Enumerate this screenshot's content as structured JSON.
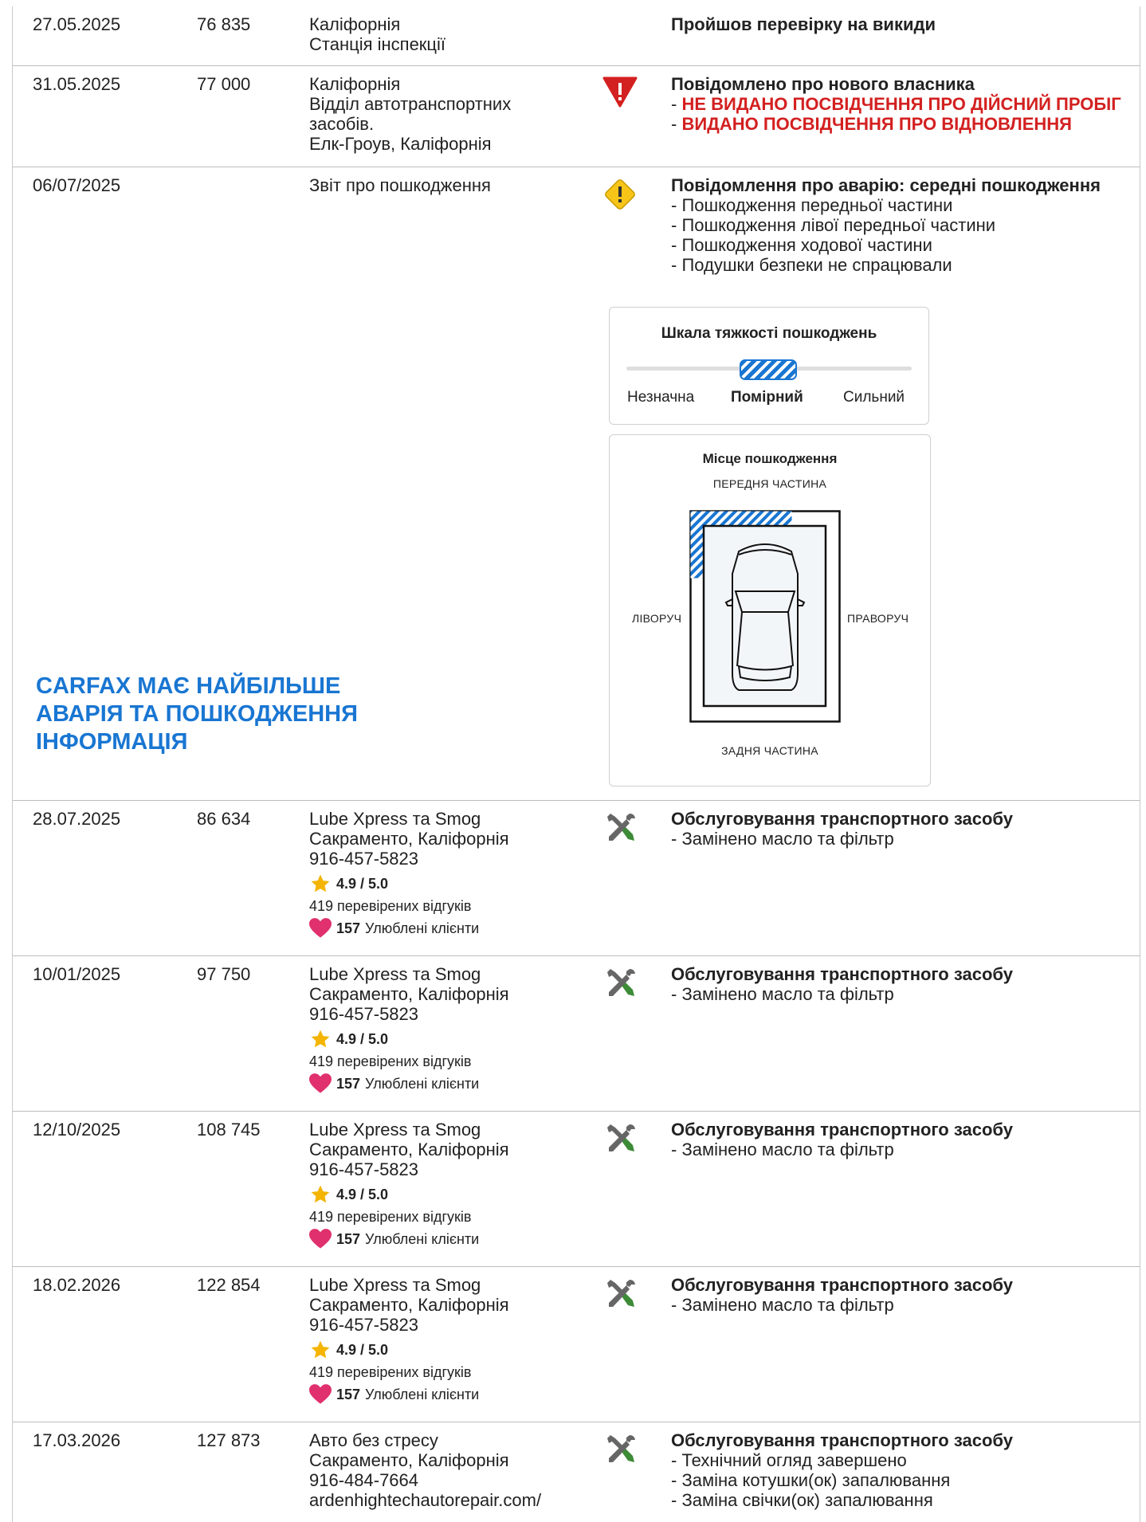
{
  "promo": {
    "line1": "CARFAX МАЄ НАЙБІЛЬШЕ",
    "line2": "АВАРІЯ ТА ПОШКОДЖЕННЯ",
    "line3": "ІНФОРМАЦІЯ"
  },
  "colors": {
    "accent_blue": "#1976d2",
    "alert_red": "#d32020",
    "warning_yellow": "#f7c518",
    "service_green": "#3d8b37",
    "heart_pink": "#e0306e",
    "star_gold": "#f4b400"
  },
  "rows": [
    {
      "date": "27.05.2025",
      "odometer": "76 835",
      "source": [
        "Каліфорнія",
        "Станція інспекції"
      ],
      "icon": "none",
      "title": "Пройшов перевірку на викиди",
      "items": []
    },
    {
      "date": "31.05.2025",
      "odometer": "77 000",
      "source": [
        "Каліфорнія",
        "Відділ автотранспортних",
        "засобів.",
        "Елк-Гроув, Каліфорнія"
      ],
      "icon": "red-alert-icon",
      "title": "Повідомлено про нового власника",
      "alerts": [
        "НЕ ВИДАНО ПОСВІДЧЕННЯ ПРО ДІЙСНИЙ ПРОБІГ",
        "ВИДАНО ПОСВІДЧЕННЯ ПРО ВІДНОВЛЕННЯ"
      ]
    },
    {
      "date": "06/07/2025",
      "odometer": "",
      "source": [
        "Звіт про пошкодження"
      ],
      "icon": "warning-diamond-icon",
      "title": "Повідомлення про аварію: середні пошкодження",
      "items": [
        "Пошкодження передньої частини",
        "Пошкодження лівої передньої частини",
        "Пошкодження ходової частини",
        "Подушки безпеки не спрацювали"
      ]
    },
    {
      "date": "28.07.2025",
      "odometer": "86 634",
      "source": [
        "Lube Xpress та Smog",
        "Сакраменто, Каліфорнія",
        "916-457-5823"
      ],
      "icon": "tools-icon",
      "title": "Обслуговування транспортного засобу",
      "items": [
        "Замінено масло та фільтр"
      ]
    },
    {
      "date": "10/01/2025",
      "odometer": "97 750",
      "source": [
        "Lube Xpress та Smog",
        "Сакраменто, Каліфорнія",
        "916-457-5823"
      ],
      "icon": "tools-icon",
      "title": "Обслуговування транспортного засобу",
      "items": [
        "Замінено масло та фільтр"
      ]
    },
    {
      "date": "12/10/2025",
      "odometer": "108 745",
      "source": [
        "Lube Xpress та Smog",
        "Сакраменто, Каліфорнія",
        "916-457-5823"
      ],
      "icon": "tools-icon",
      "title": "Обслуговування транспортного засобу",
      "items": [
        "Замінено масло та фільтр"
      ]
    },
    {
      "date": "18.02.2026",
      "odometer": "122 854",
      "source": [
        "Lube Xpress та Smog",
        "Сакраменто, Каліфорнія",
        "916-457-5823"
      ],
      "icon": "tools-icon",
      "title": "Обслуговування транспортного засобу",
      "items": [
        "Замінено масло та фільтр"
      ]
    },
    {
      "date": "17.03.2026",
      "odometer": "127 873",
      "source": [
        "Авто без стресу",
        "Сакраменто, Каліфорнія",
        "916-484-7664",
        "ardenhightechautorepair.com/"
      ],
      "icon": "tools-icon",
      "title": "Обслуговування транспортного засобу",
      "items": [
        "Технічний огляд завершено",
        "Заміна котушки(ок) запалювання",
        "Заміна свічки(ок) запалювання"
      ]
    }
  ],
  "shop_meta": {
    "rating": "4.9 / 5.0",
    "reviews": "419 перевірених відгуків",
    "favorites_count": "157",
    "favorites_label": "Улюблені клієнти"
  },
  "severity": {
    "title": "Шкала тяжкості пошкоджень",
    "minor": "Незначна",
    "moderate": "Помірний",
    "severe": "Сильний",
    "level": "moderate"
  },
  "location": {
    "title": "Місце пошкодження",
    "front": "ПЕРЕДНЯ ЧАСТИНА",
    "left": "ЛІВОРУЧ",
    "right": "ПРАВОРУЧ",
    "rear": "ЗАДНЯ ЧАСТИНА",
    "damaged_area": "left-front"
  }
}
